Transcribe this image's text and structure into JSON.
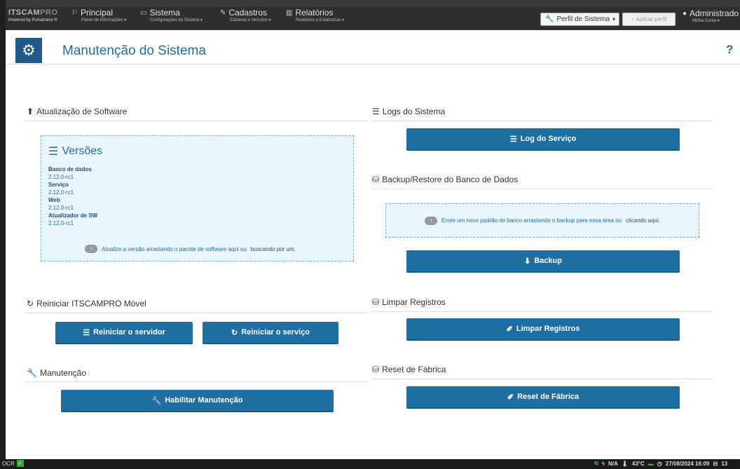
{
  "navbar": {
    "logo_main": "ITSCAM",
    "logo_pro": "PRO",
    "logo_powered": "Powered by Pumatronix ®",
    "principal": {
      "title": "Principal",
      "sub": "Painel de Informações ▾"
    },
    "sistema": {
      "title": "Sistema",
      "sub": "Configurações do Sistema ▾"
    },
    "cadastros": {
      "title": "Cadastros",
      "sub": "Câmeras e Veículos ▾"
    },
    "relatorios": {
      "title": "Relatórios",
      "sub": "Relatórios e Estatísticas ▾"
    },
    "profile_select": "Perfil de Sistema",
    "apply_profile": "Aplicar perfil",
    "admin": {
      "title": "Administrado",
      "sub": "Minha Conta ▾"
    }
  },
  "header": {
    "title": "Manutenção do Sistema",
    "help": "?"
  },
  "software_update": {
    "title": "Atualização de Software",
    "versions_title": "Versões",
    "versions": [
      {
        "key": "Banco de dados",
        "value": "2.12.0-rc1"
      },
      {
        "key": "Serviço",
        "value": "2.12.0-rc1"
      },
      {
        "key": "Web",
        "value": "2.12.0-rc1"
      },
      {
        "key": "Atualizador de SW",
        "value": "2.12.0-rc1"
      }
    ],
    "upload_text": "Atualize a versão arrastando o pacote de software aqui ou",
    "upload_link": "buscando por um."
  },
  "restart": {
    "title": "Reiniciar ITSCAMPRO Móvel",
    "restart_server": "Reiniciar o servidor",
    "restart_service": "Reiniciar o serviço"
  },
  "maintenance": {
    "title": "Manutenção",
    "enable_button": "Habilitar Manutenção"
  },
  "logs": {
    "title": "Logs do Sistema",
    "service_log": "Log do Serviço"
  },
  "backup": {
    "title": "Backup/Restore do Banco de Dados",
    "drop_text": "Envie um novo padrão de banco arrastando o backup para essa área ou",
    "drop_link": "clicando aqui.",
    "backup_button": "Backup"
  },
  "clear": {
    "title": "Limpar Registros",
    "button": "Limpar Registros"
  },
  "factory": {
    "title": "Reset de Fábrica",
    "button": "Reset de Fábrica"
  },
  "statusbar": {
    "ocr": "OCR",
    "na": "N/A",
    "temp": "43°C",
    "datetime": "27/08/2024 16:09",
    "tail": "13"
  },
  "colors": {
    "primary": "#1f6fa3",
    "navbar": "#2f2f2f",
    "status_green": "#3aa83a"
  }
}
